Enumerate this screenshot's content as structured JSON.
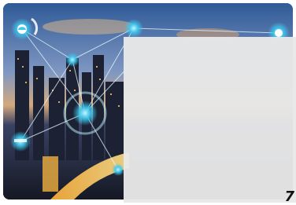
{
  "hero_image": {
    "description_icon": "smart-city-network-image",
    "accent_color": "#3cc8f0",
    "glow_color": "#9ff3ff"
  },
  "overlay_panel": {
    "background": "#e8e8e8"
  },
  "corner_glyph": {
    "text": "7"
  }
}
